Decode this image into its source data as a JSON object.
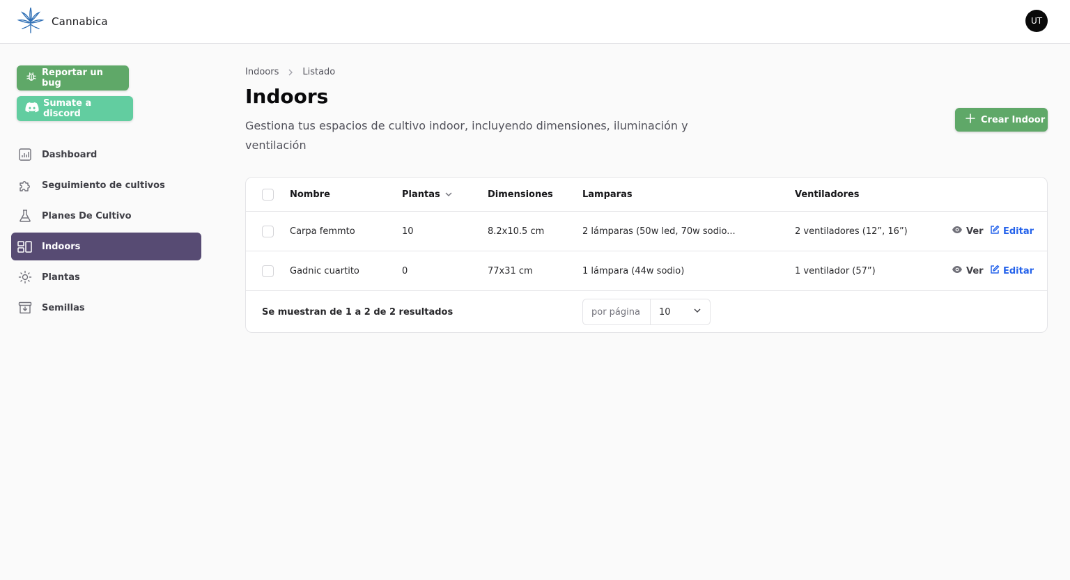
{
  "app": {
    "name": "Cannabica",
    "user_initials": "UT"
  },
  "sidebar": {
    "bug_button": "Reportar un bug",
    "discord_button": "Sumate a discord",
    "items": [
      {
        "label": "Dashboard",
        "icon": "chart-icon"
      },
      {
        "label": "Seguimiento de cultivos",
        "icon": "puzzle-icon"
      },
      {
        "label": "Planes De Cultivo",
        "icon": "flask-icon"
      },
      {
        "label": "Indoors",
        "icon": "layout-icon",
        "active": true
      },
      {
        "label": "Plantas",
        "icon": "sun-icon"
      },
      {
        "label": "Semillas",
        "icon": "archive-icon"
      }
    ]
  },
  "breadcrumb": {
    "root": "Indoors",
    "current": "Listado"
  },
  "page": {
    "title": "Indoors",
    "description": "Gestiona tus espacios de cultivo indoor, incluyendo dimensiones, iluminación y ventilación",
    "create_button": "Crear Indoor"
  },
  "table": {
    "columns": [
      "Nombre",
      "Plantas",
      "Dimensiones",
      "Lamparas",
      "Ventiladores"
    ],
    "rows": [
      {
        "nombre": "Carpa femmto",
        "plantas": "10",
        "dimensiones": "8.2x10.5 cm",
        "lamparas": "2 lámparas (50w led, 70w sodio...",
        "ventiladores": "2 ventiladores (12”, 16”)"
      },
      {
        "nombre": "Gadnic cuartito",
        "plantas": "0",
        "dimensiones": "77x31 cm",
        "lamparas": "1 lámpara (44w sodio)",
        "ventiladores": "1 ventilador (57”)"
      }
    ],
    "actions": {
      "view": "Ver",
      "edit": "Editar"
    },
    "footer": {
      "results": "Se muestran de 1 a 2 de 2 resultados",
      "per_page_label": "por página",
      "per_page_value": "10"
    }
  },
  "colors": {
    "primary_green": "#5fa868",
    "discord_green": "#62cda0",
    "active_nav": "#574b73",
    "link_blue": "#2563eb"
  }
}
